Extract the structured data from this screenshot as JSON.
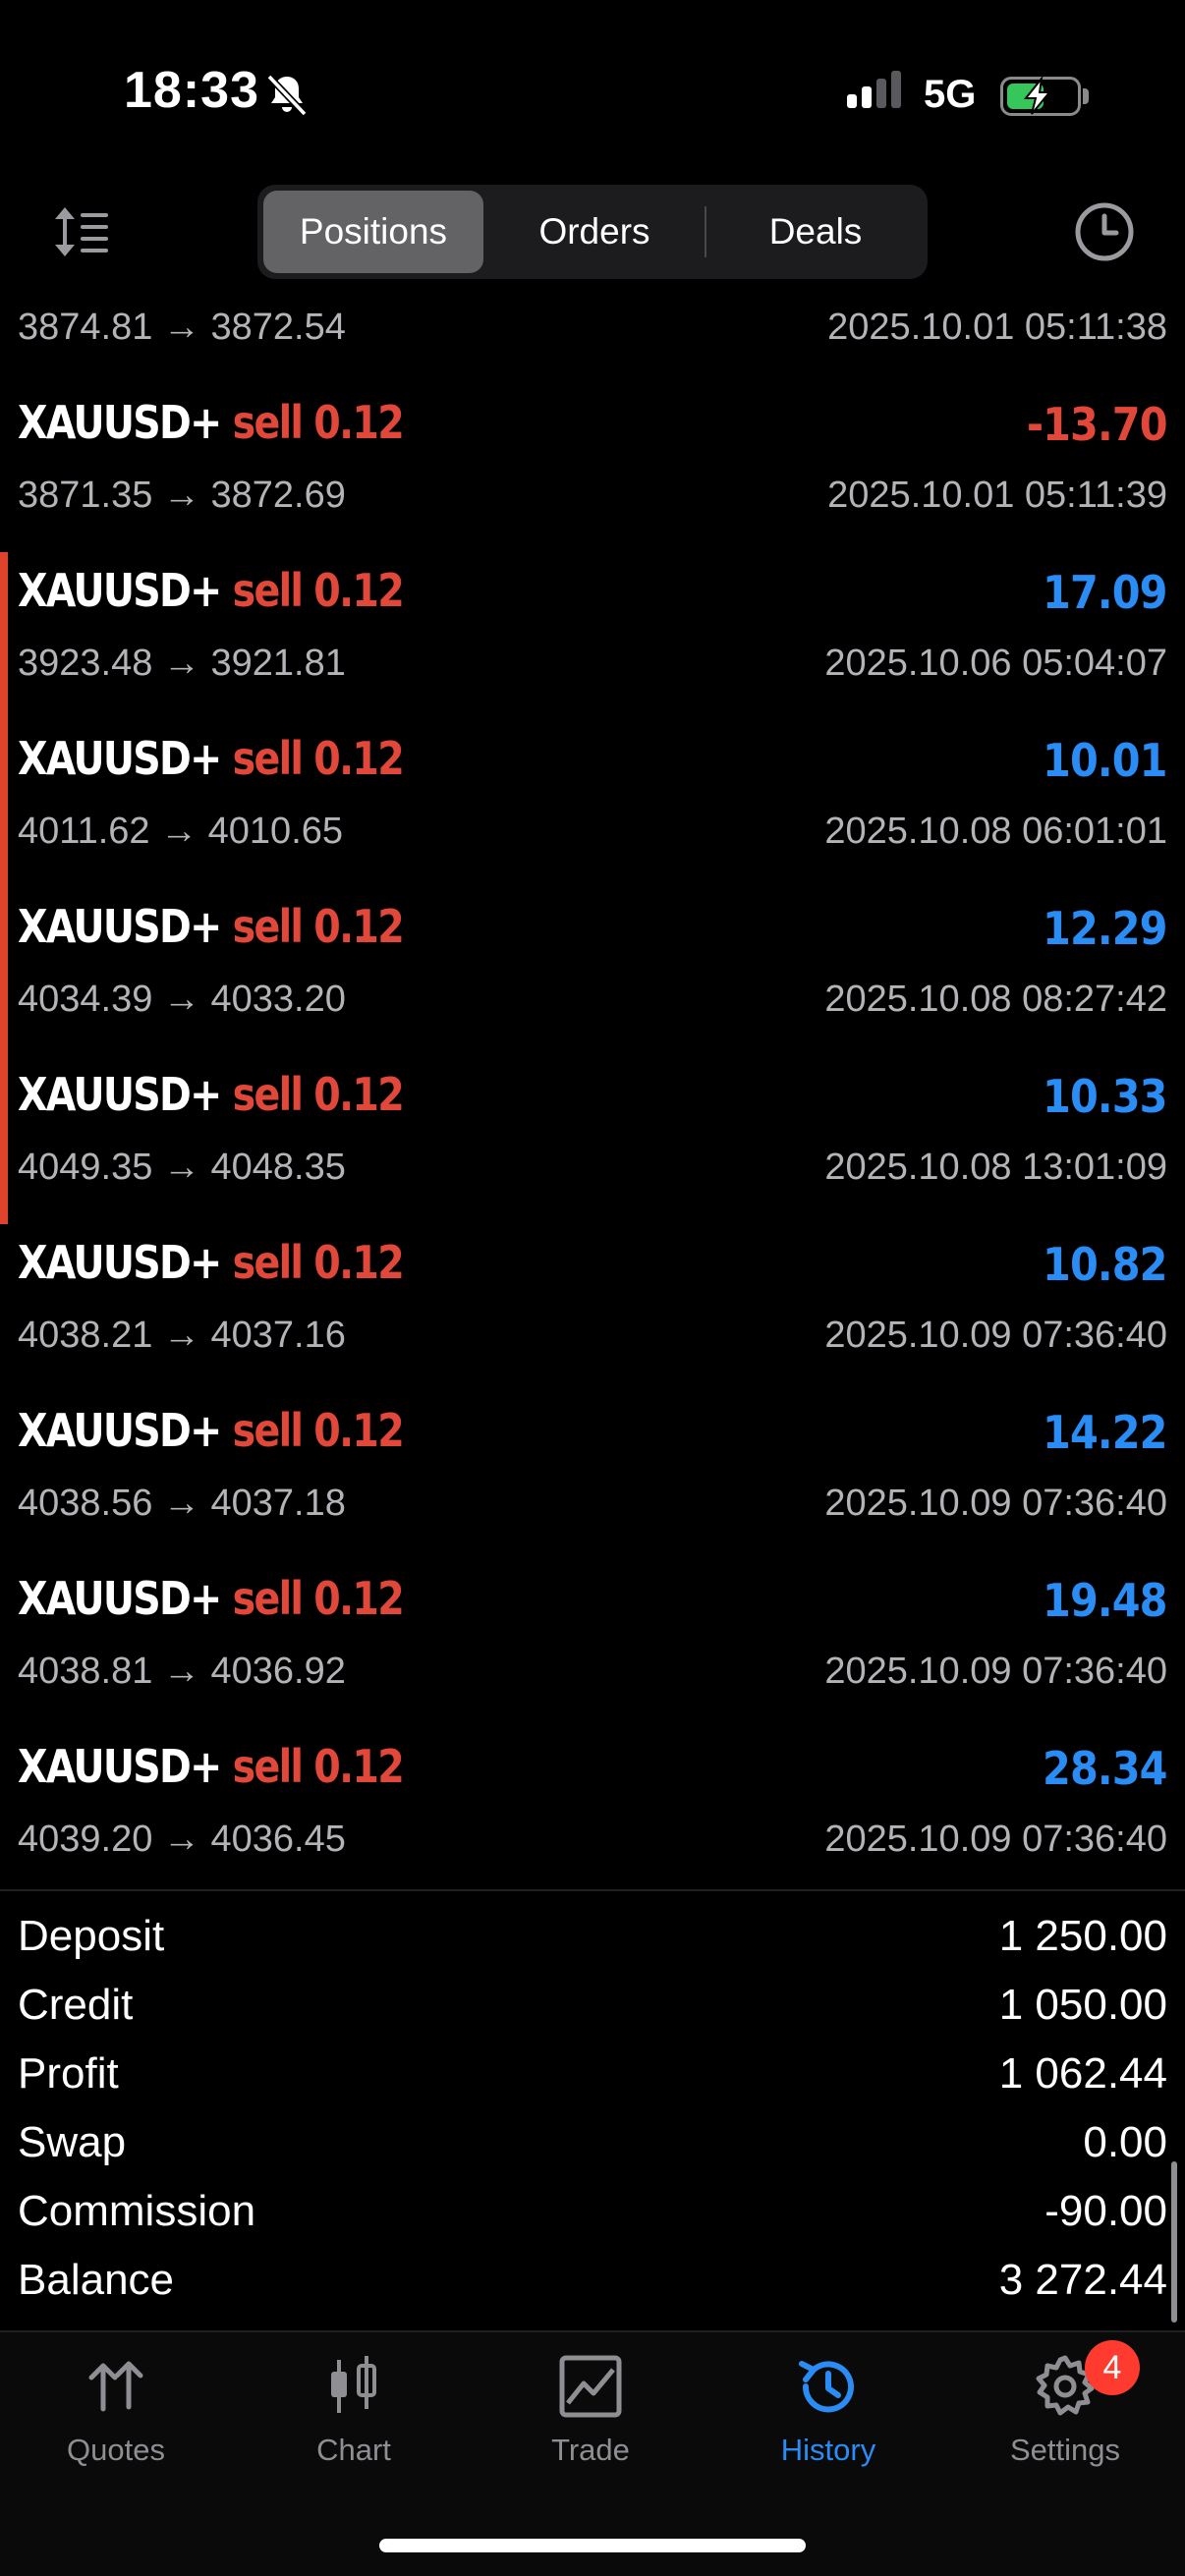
{
  "status_bar": {
    "time": "18:33",
    "network": "5G",
    "battery_level": 0.55,
    "icons": [
      "bell-slash-icon",
      "signal-icon",
      "battery-charging-icon"
    ]
  },
  "toolbar": {
    "tabs": [
      {
        "label": "Positions",
        "active": true
      },
      {
        "label": "Orders",
        "active": false
      },
      {
        "label": "Deals",
        "active": false
      }
    ],
    "left_icon": "sort-icon",
    "right_icon": "clock-icon"
  },
  "deals": [
    {
      "symbol": "",
      "side": "",
      "profit": "",
      "prices": "3874.81 → 3872.54",
      "time": "2025.10.01 05:11:38",
      "partial": true
    },
    {
      "symbol": "XAUUSD+",
      "side": "sell 0.12",
      "profit": "-13.70",
      "profit_sign": "neg",
      "prices": "3871.35 → 3872.69",
      "time": "2025.10.01 05:11:39"
    },
    {
      "symbol": "XAUUSD+",
      "side": "sell 0.12",
      "profit": "17.09",
      "profit_sign": "pos",
      "prices": "3923.48 → 3921.81",
      "time": "2025.10.06 05:04:07",
      "marked": true
    },
    {
      "symbol": "XAUUSD+",
      "side": "sell 0.12",
      "profit": "10.01",
      "profit_sign": "pos",
      "prices": "4011.62 → 4010.65",
      "time": "2025.10.08 06:01:01",
      "marked": true
    },
    {
      "symbol": "XAUUSD+",
      "side": "sell 0.12",
      "profit": "12.29",
      "profit_sign": "pos",
      "prices": "4034.39 → 4033.20",
      "time": "2025.10.08 08:27:42",
      "marked": true
    },
    {
      "symbol": "XAUUSD+",
      "side": "sell 0.12",
      "profit": "10.33",
      "profit_sign": "pos",
      "prices": "4049.35 → 4048.35",
      "time": "2025.10.08 13:01:09",
      "marked": true
    },
    {
      "symbol": "XAUUSD+",
      "side": "sell 0.12",
      "profit": "10.82",
      "profit_sign": "pos",
      "prices": "4038.21 → 4037.16",
      "time": "2025.10.09 07:36:40"
    },
    {
      "symbol": "XAUUSD+",
      "side": "sell 0.12",
      "profit": "14.22",
      "profit_sign": "pos",
      "prices": "4038.56 → 4037.18",
      "time": "2025.10.09 07:36:40"
    },
    {
      "symbol": "XAUUSD+",
      "side": "sell 0.12",
      "profit": "19.48",
      "profit_sign": "pos",
      "prices": "4038.81 → 4036.92",
      "time": "2025.10.09 07:36:40"
    },
    {
      "symbol": "XAUUSD+",
      "side": "sell 0.12",
      "profit": "28.34",
      "profit_sign": "pos",
      "prices": "4039.20 → 4036.45",
      "time": "2025.10.09 07:36:40"
    }
  ],
  "summary": [
    {
      "label": "Deposit",
      "value": "1 250.00"
    },
    {
      "label": "Credit",
      "value": "1 050.00"
    },
    {
      "label": "Profit",
      "value": "1 062.44"
    },
    {
      "label": "Swap",
      "value": "0.00"
    },
    {
      "label": "Commission",
      "value": "-90.00"
    },
    {
      "label": "Balance",
      "value": "3 272.44"
    }
  ],
  "tab_bar": {
    "items": [
      {
        "label": "Quotes",
        "icon": "arrows-updown-icon",
        "active": false
      },
      {
        "label": "Chart",
        "icon": "candlestick-icon",
        "active": false
      },
      {
        "label": "Trade",
        "icon": "trade-chart-icon",
        "active": false
      },
      {
        "label": "History",
        "icon": "history-icon",
        "active": true
      },
      {
        "label": "Settings",
        "icon": "gear-icon",
        "active": false
      }
    ],
    "settings_badge": "4"
  },
  "colors": {
    "positive": "#2a8cf5",
    "negative": "#e2483a",
    "marker": "#e0432c",
    "active_tab": "#2a8cf5"
  }
}
